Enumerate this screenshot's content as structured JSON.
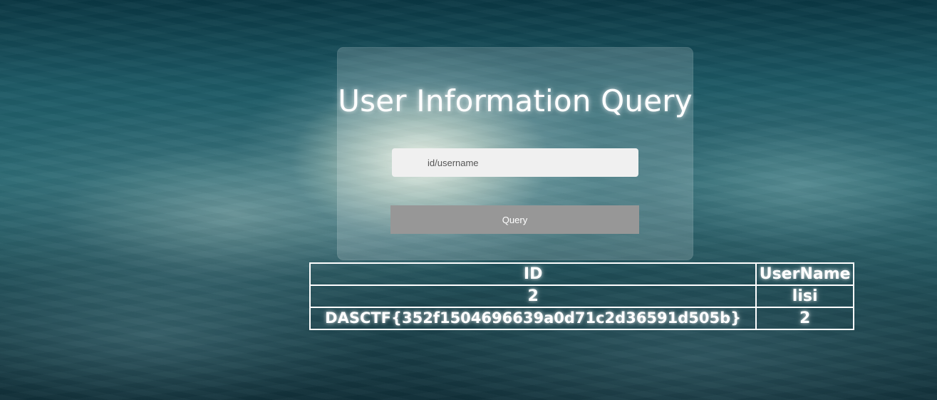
{
  "page": {
    "title": "User Information Query"
  },
  "search": {
    "placeholder": "id/username",
    "value": ""
  },
  "query_button": {
    "label": "Query"
  },
  "table": {
    "headers": [
      "ID",
      "UserName"
    ],
    "rows": [
      [
        "2",
        "lisi"
      ],
      [
        "DASCTF{352f1504696639a0d71c2d36591d505b}",
        "2"
      ]
    ]
  },
  "colors": {
    "card_background": "#ffffff",
    "input_background": "#f0f0f0",
    "button_background": "#979797",
    "table_border": "#ffffff",
    "text": "#ffffff"
  }
}
